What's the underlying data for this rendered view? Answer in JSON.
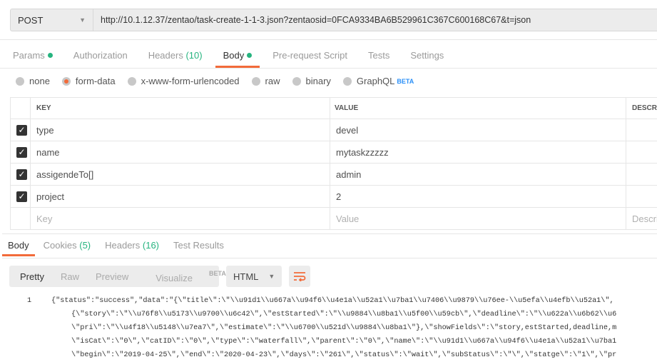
{
  "request": {
    "method": "POST",
    "url": "http://10.1.12.37/zentao/task-create-1-1-3.json?zentaosid=0FCA9334BA6B529961C367C600168C67&t=json"
  },
  "tabs": [
    {
      "label": "Params"
    },
    {
      "label": "Authorization"
    },
    {
      "label": "Headers",
      "count": "(10)"
    },
    {
      "label": "Body"
    },
    {
      "label": "Pre-request Script"
    },
    {
      "label": "Tests"
    },
    {
      "label": "Settings"
    }
  ],
  "body_types": [
    {
      "label": "none"
    },
    {
      "label": "form-data",
      "selected": true
    },
    {
      "label": "x-www-form-urlencoded"
    },
    {
      "label": "raw"
    },
    {
      "label": "binary"
    },
    {
      "label": "GraphQL",
      "badge": "BETA"
    }
  ],
  "table": {
    "headers": [
      "KEY",
      "VALUE",
      "DESCRI"
    ],
    "rows": [
      {
        "key": "type",
        "value": "devel",
        "checked": true
      },
      {
        "key": "name",
        "value": "mytaskzzzzz",
        "checked": true
      },
      {
        "key": "assigendeTo[]",
        "value": "admin",
        "checked": true
      },
      {
        "key": "project",
        "value": "2",
        "checked": true
      }
    ],
    "placeholder": {
      "key": "Key",
      "value": "Value",
      "desc": "Descri"
    }
  },
  "response": {
    "tabs": [
      {
        "label": "Body"
      },
      {
        "label": "Cookies",
        "count": "(5)"
      },
      {
        "label": "Headers",
        "count": "(16)"
      },
      {
        "label": "Test Results"
      }
    ],
    "views": [
      "Pretty",
      "Raw",
      "Preview",
      "Visualize"
    ],
    "beta": "BETA",
    "format": "HTML",
    "line_number": "1",
    "lines": [
      "{\"status\":\"success\",\"data\":\"{\\\"title\\\":\\\"\\\\u91d1\\\\u667a\\\\u94f6\\\\u4e1a\\\\u52a1\\\\u7ba1\\\\u7406\\\\u9879\\\\u76ee-\\\\u5efa\\\\u4efb\\\\u52a1\\\",",
      "{\\\"story\\\":\\\"\\\\u76f8\\\\u5173\\\\u9700\\\\u6c42\\\",\\\"estStarted\\\":\\\"\\\\u9884\\\\u8ba1\\\\u5f00\\\\u59cb\\\",\\\"deadline\\\":\\\"\\\\u622a\\\\u6b62\\\\u6",
      "\\\"pri\\\":\\\"\\\\u4f18\\\\u5148\\\\u7ea7\\\",\\\"estimate\\\":\\\"\\\\u6700\\\\u521d\\\\u9884\\\\u8ba1\\\"},\\\"showFields\\\":\\\"story,estStarted,deadline,m",
      "\\\"isCat\\\":\\\"0\\\",\\\"catID\\\":\\\"0\\\",\\\"type\\\":\\\"waterfall\\\",\\\"parent\\\":\\\"0\\\",\\\"name\\\":\\\"\\\\u91d1\\\\u667a\\\\u94f6\\\\u4e1a\\\\u52a1\\\\u7ba1",
      "\\\"begin\\\":\\\"2019-04-25\\\",\\\"end\\\":\\\"2020-04-23\\\",\\\"days\\\":\\\"261\\\",\\\"status\\\":\\\"wait\\\",\\\"subStatus\\\":\\\"\\\",\\\"statge\\\":\\\"1\\\",\\\"pr"
    ]
  },
  "colors": {
    "accent": "#f26b3a",
    "green": "#26b47f",
    "beta": "#2a8ff7"
  }
}
